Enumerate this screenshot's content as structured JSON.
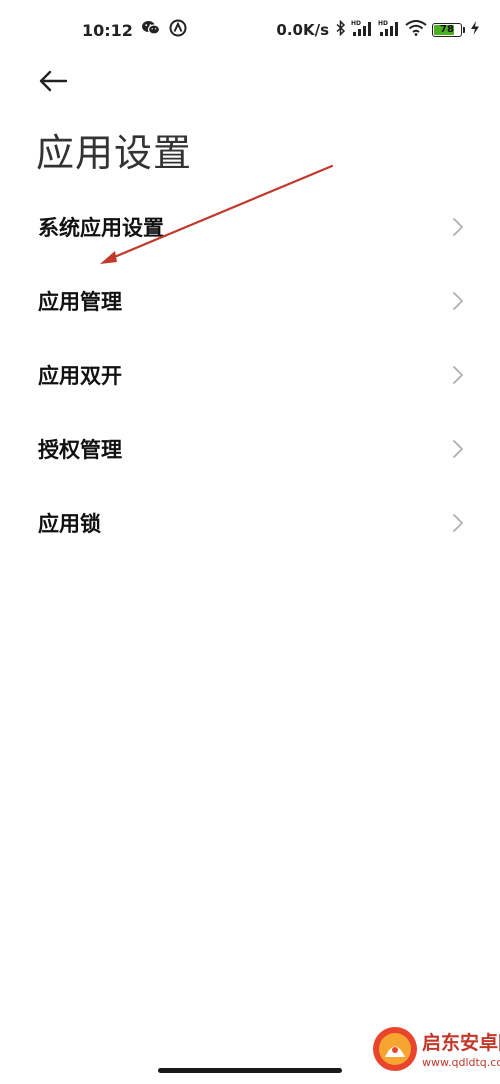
{
  "status_bar": {
    "time": "10:12",
    "net_speed": "0.0K/s",
    "battery": "78",
    "battery_level": 0.78,
    "left_icons": [
      "wechat-icon",
      "signal-app-icon"
    ],
    "right_icons": [
      "bluetooth-icon",
      "hd-signal-icon",
      "hd-signal-icon",
      "wifi-icon",
      "battery-icon",
      "charging-icon"
    ]
  },
  "header": {
    "back_icon": "arrow-left-icon",
    "title": "应用设置"
  },
  "menu": {
    "items": [
      {
        "label": "系统应用设置"
      },
      {
        "label": "应用管理"
      },
      {
        "label": "应用双开"
      },
      {
        "label": "授权管理"
      },
      {
        "label": "应用锁"
      }
    ]
  },
  "watermark": {
    "name": "启东安卓网",
    "url": "www.qdldtq.com"
  },
  "colors": {
    "battery_green": "#4caf20",
    "annotation_red": "#c0392b",
    "chevron_gray": "#b0b0b0"
  }
}
